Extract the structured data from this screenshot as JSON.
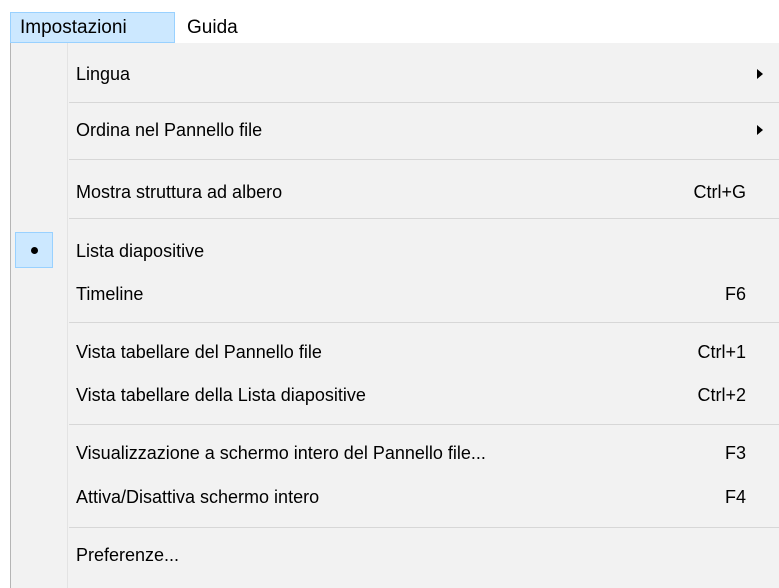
{
  "menubar": {
    "items": [
      {
        "label": "Impostazioni"
      },
      {
        "label": "Guida"
      }
    ]
  },
  "menu": {
    "items": [
      {
        "label": "Lingua",
        "shortcut": ""
      },
      {
        "label": "Ordina nel Pannello file",
        "shortcut": ""
      },
      {
        "label": "Mostra struttura ad albero",
        "shortcut": "Ctrl+G"
      },
      {
        "label": "Lista diapositive",
        "shortcut": ""
      },
      {
        "label": "Timeline",
        "shortcut": "F6"
      },
      {
        "label": "Vista tabellare del Pannello file",
        "shortcut": "Ctrl+1"
      },
      {
        "label": "Vista tabellare della Lista diapositive",
        "shortcut": "Ctrl+2"
      },
      {
        "label": "Visualizzazione a schermo intero del Pannello file...",
        "shortcut": "F3"
      },
      {
        "label": "Attiva/Disattiva schermo intero",
        "shortcut": "F4"
      },
      {
        "label": "Preferenze...",
        "shortcut": ""
      }
    ]
  },
  "colors": {
    "highlight": "#cce8ff",
    "highlight_border": "#99d1ff",
    "menu_background": "#f2f2f2"
  }
}
